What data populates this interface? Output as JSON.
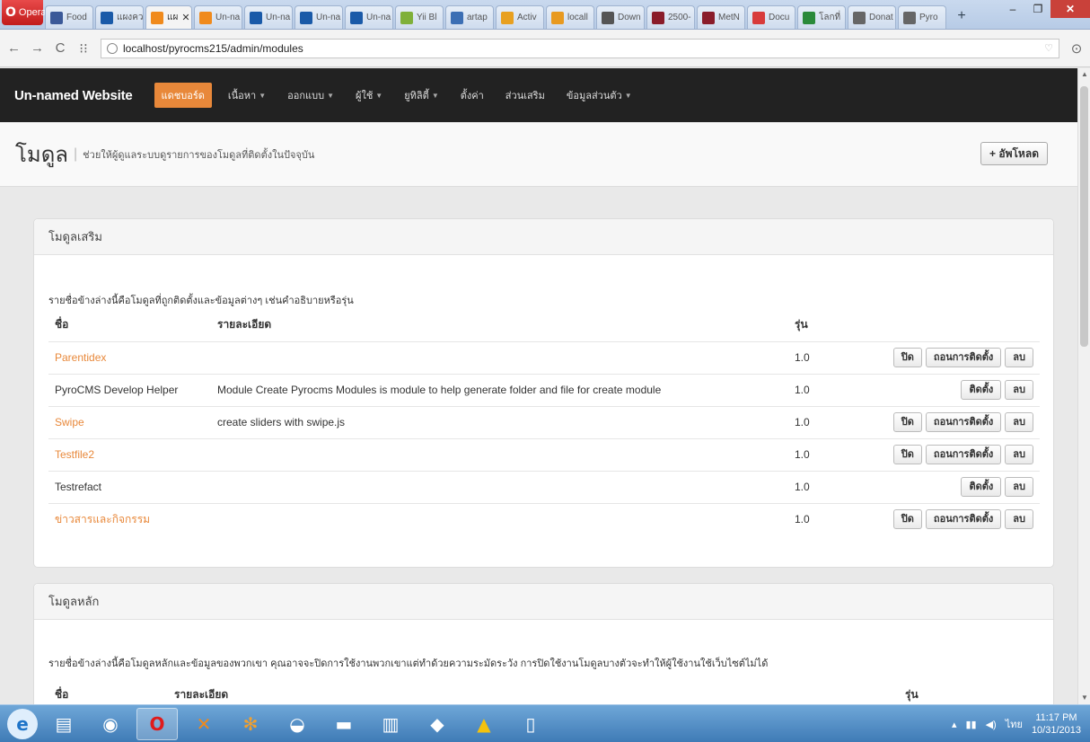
{
  "browser": {
    "opera_label": "Opera",
    "tabs": [
      {
        "label": "Food",
        "color": "#3b5998"
      },
      {
        "label": "แผงควบ",
        "color": "#1a5aa8"
      },
      {
        "label": "แผ",
        "color": "#f08a1c",
        "active": true
      },
      {
        "label": "Un-na",
        "color": "#f08a1c"
      },
      {
        "label": "Un-na",
        "color": "#1a5aa8"
      },
      {
        "label": "Un-na",
        "color": "#1a5aa8"
      },
      {
        "label": "Un-na",
        "color": "#1a5aa8"
      },
      {
        "label": "Yii Bl",
        "color": "#7fb03a"
      },
      {
        "label": "artap",
        "color": "#3c6fb4"
      },
      {
        "label": "Activ",
        "color": "#e8a020"
      },
      {
        "label": "locall",
        "color": "#e89a20"
      },
      {
        "label": "Down",
        "color": "#555555"
      },
      {
        "label": "2500-",
        "color": "#8a1c2a"
      },
      {
        "label": "MetN",
        "color": "#8a1c2a"
      },
      {
        "label": "Docu",
        "color": "#d83b3b"
      },
      {
        "label": "โลกที่",
        "color": "#2a8a3a"
      },
      {
        "label": "Donat",
        "color": "#666666"
      },
      {
        "label": "Pyro",
        "color": "#666666"
      }
    ],
    "url": "localhost/pyrocms215/admin/modules"
  },
  "site": {
    "brand": "Un-named Website",
    "nav": [
      {
        "label": "แดชบอร์ด",
        "active": true,
        "dropdown": false
      },
      {
        "label": "เนื้อหา",
        "dropdown": true
      },
      {
        "label": "ออกแบบ",
        "dropdown": true
      },
      {
        "label": "ผู้ใช้",
        "dropdown": true
      },
      {
        "label": "ยูทิลิตี้",
        "dropdown": true
      },
      {
        "label": "ตั้งค่า",
        "dropdown": false
      },
      {
        "label": "ส่วนเสริม",
        "dropdown": false
      },
      {
        "label": "ข้อมูลส่วนตัว",
        "dropdown": true
      }
    ]
  },
  "page": {
    "title": "โมดูล",
    "separator": "|",
    "subtitle": "ช่วยให้ผู้ดูแลระบบดูรายการของโมดูลที่ติดตั้งในปัจจุบัน",
    "upload_label": "+ อัพโหลด"
  },
  "addon_modules": {
    "heading": "โมดูลเสริม",
    "description": "รายชื่อข้างล่างนี้คือโมดูลที่ถูกติดตั้งและข้อมูลต่างๆ เช่นคำอธิบายหรือรุ่น",
    "columns": {
      "name": "ชื่อ",
      "desc": "รายละเอียด",
      "version": "รุ่น"
    },
    "rows": [
      {
        "name": "Parentidex",
        "desc": "",
        "version": "1.0",
        "link": true,
        "actions": [
          "ปิด",
          "ถอนการติดตั้ง",
          "ลบ"
        ]
      },
      {
        "name": "PyroCMS Develop Helper",
        "desc": "Module Create Pyrocms Modules is module to help generate folder and file for create module",
        "version": "1.0",
        "link": false,
        "actions": [
          "ติดตั้ง",
          "ลบ"
        ]
      },
      {
        "name": "Swipe",
        "desc": "create sliders with swipe.js",
        "version": "1.0",
        "link": true,
        "actions": [
          "ปิด",
          "ถอนการติดตั้ง",
          "ลบ"
        ]
      },
      {
        "name": "Testfile2",
        "desc": "",
        "version": "1.0",
        "link": true,
        "actions": [
          "ปิด",
          "ถอนการติดตั้ง",
          "ลบ"
        ]
      },
      {
        "name": "Testrefact",
        "desc": "",
        "version": "1.0",
        "link": false,
        "actions": [
          "ติดตั้ง",
          "ลบ"
        ]
      },
      {
        "name": "ข่าวสารและกิจกรรม",
        "desc": "",
        "version": "1.0",
        "link": true,
        "actions": [
          "ปิด",
          "ถอนการติดตั้ง",
          "ลบ"
        ]
      }
    ]
  },
  "core_modules": {
    "heading": "โมดูลหลัก",
    "description": "รายชื่อข้างล่างนี้คือโมดูลหลักและข้อมูลของพวกเขา คุณอาจจะปิดการใช้งานพวกเขาแต่ทำด้วยความระมัดระวัง การปิดใช้งานโมดูลบางตัวจะทำให้ผู้ใช้งานใช้เว็บไซต์ไม่ได้",
    "columns": {
      "name": "ชื่อ",
      "desc": "รายละเอียด",
      "version": "รุ่น"
    }
  },
  "taskbar": {
    "language": "ไทย",
    "time": "11:17 PM",
    "date": "10/31/2013"
  },
  "colors": {
    "accent": "#e8883a",
    "navbar": "#222222"
  }
}
